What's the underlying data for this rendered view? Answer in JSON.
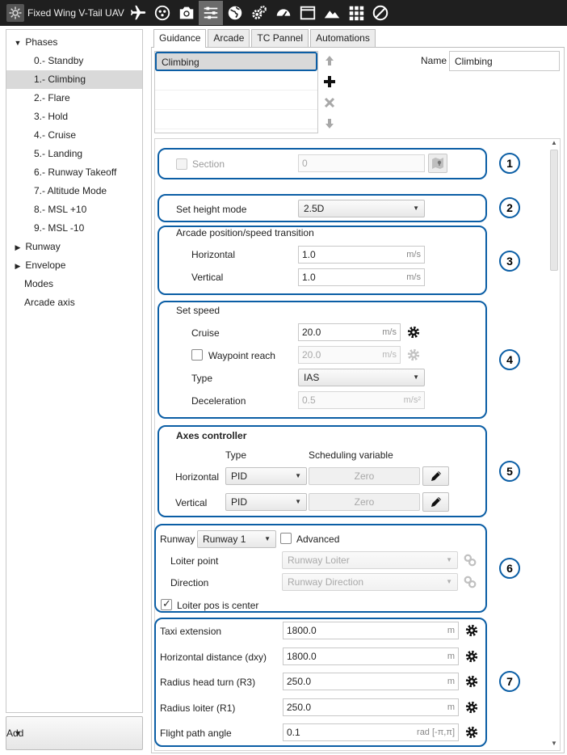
{
  "app": {
    "title": "Fixed Wing V-Tail UAV"
  },
  "toolbar": {
    "icons": [
      "plane-icon",
      "dots-icon",
      "camera-icon",
      "sliders-icon",
      "globe-icon",
      "gears-icon",
      "gauge-icon",
      "window-icon",
      "mountain-icon",
      "grid-icon",
      "prohibited-icon"
    ],
    "active": "sliders-icon"
  },
  "tree": {
    "phases_label": "Phases",
    "phases": [
      "0.- Standby",
      "1.- Climbing",
      "2.- Flare",
      "3.- Hold",
      "4.- Cruise",
      "5.- Landing",
      "6.- Runway Takeoff",
      "7.- Altitude Mode",
      "8.- MSL +10",
      "9.- MSL -10"
    ],
    "selected": "1.- Climbing",
    "runway": "Runway",
    "envelope": "Envelope",
    "modes": "Modes",
    "arcade_axis": "Arcade axis"
  },
  "add_button": {
    "label": "Add"
  },
  "tabs": [
    "Guidance",
    "Arcade",
    "TC Pannel",
    "Automations"
  ],
  "active_tab": "Guidance",
  "phase_list": {
    "selected": "Climbing"
  },
  "name_field": {
    "label": "Name",
    "value": "Climbing"
  },
  "badges": [
    "1",
    "2",
    "3",
    "4",
    "5",
    "6",
    "7"
  ],
  "s1": {
    "section_label": "Section",
    "section_value": "0"
  },
  "s2": {
    "label": "Set height mode",
    "value": "2.5D"
  },
  "s3": {
    "title": "Arcade position/speed transition",
    "horizontal_label": "Horizontal",
    "horizontal_value": "1.0",
    "horizontal_unit": "m/s",
    "vertical_label": "Vertical",
    "vertical_value": "1.0",
    "vertical_unit": "m/s"
  },
  "s4": {
    "title": "Set speed",
    "cruise_label": "Cruise",
    "cruise_value": "20.0",
    "cruise_unit": "m/s",
    "waypoint_label": "Waypoint reach",
    "waypoint_value": "20.0",
    "waypoint_unit": "m/s",
    "type_label": "Type",
    "type_value": "IAS",
    "decel_label": "Deceleration",
    "decel_value": "0.5",
    "decel_unit": "m/s²"
  },
  "s5": {
    "title": "Axes controller",
    "type_header": "Type",
    "sched_header": "Scheduling variable",
    "horizontal_label": "Horizontal",
    "horizontal_type": "PID",
    "horizontal_sched": "Zero",
    "vertical_label": "Vertical",
    "vertical_type": "PID",
    "vertical_sched": "Zero"
  },
  "s6": {
    "runway_label": "Runway",
    "runway_value": "Runway 1",
    "advanced_label": "Advanced",
    "loiter_label": "Loiter point",
    "loiter_value": "Runway Loiter",
    "direction_label": "Direction",
    "direction_value": "Runway Direction",
    "center_label": "Loiter pos is center"
  },
  "s7": {
    "taxi_label": "Taxi extension",
    "taxi_value": "1800.0",
    "taxi_unit": "m",
    "dxy_label": "Horizontal distance (dxy)",
    "dxy_value": "1800.0",
    "dxy_unit": "m",
    "r3_label": "Radius head turn (R3)",
    "r3_value": "250.0",
    "r3_unit": "m",
    "r1_label": "Radius loiter (R1)",
    "r1_value": "250.0",
    "r1_unit": "m",
    "fpa_label": "Flight path angle",
    "fpa_value": "0.1",
    "fpa_unit": "rad [-π,π]"
  },
  "colors": {
    "accent": "#0b5ea5",
    "toolbar_bg": "#1f1f1f",
    "selected_row": "#d9d9d9"
  }
}
